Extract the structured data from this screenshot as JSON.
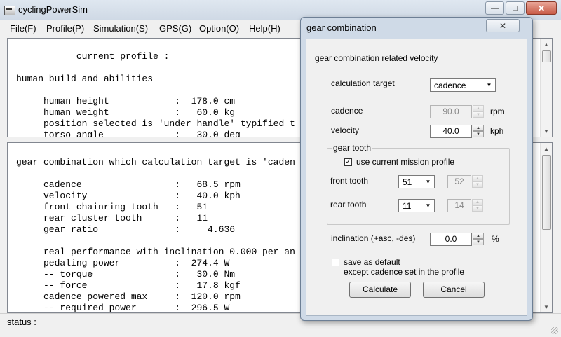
{
  "window": {
    "title": "cyclingPowerSim",
    "icon": "app-icon"
  },
  "menu": [
    "File(F)",
    "Profile(P)",
    "Simulation(S)",
    "GPS(G)",
    "Option(O)",
    "Help(H)"
  ],
  "top_pane": {
    "lines": [
      "           current profile :",
      "",
      "human build and abilities",
      "",
      "     human height            :  178.0 cm",
      "     human weight            :   60.0 kg",
      "     position selected is 'under handle' typified t",
      "     torso angle             :   30.0 deg"
    ]
  },
  "bottom_pane": {
    "lines": [
      "gear combination which calculation target is 'caden",
      "",
      "     cadence                 :   68.5 rpm",
      "     velocity                :   40.0 kph",
      "     front chainring tooth   :   51",
      "     rear cluster tooth      :   11",
      "     gear ratio              :     4.636",
      "",
      "     real performance with inclination 0.000 per an",
      "     pedaling power          :  274.4 W",
      "     -- torque               :   30.0 Nm",
      "     -- force                :   17.8 kgf",
      "     cadence powered max     :  120.0 rpm",
      "     -- required power       :  296.5 W"
    ]
  },
  "status": {
    "label": "status :"
  },
  "dialog": {
    "title": "gear combination",
    "heading": "gear combination related velocity",
    "calc_target_label": "calculation target",
    "calc_target_value": "cadence",
    "cadence_label": "cadence",
    "cadence_value": "90.0",
    "cadence_unit": "rpm",
    "velocity_label": "velocity",
    "velocity_value": "40.0",
    "velocity_unit": "kph",
    "gear_group_title": "gear tooth",
    "use_mission_label": "use current mission profile",
    "use_mission_checked": true,
    "front_label": "front tooth",
    "front_value": "51",
    "front_spin_value": "52",
    "rear_label": "rear tooth",
    "rear_value": "11",
    "rear_spin_value": "14",
    "incl_label": "inclination (+asc, -des)",
    "incl_value": "0.0",
    "incl_unit": "%",
    "save_default_line1": "save as default",
    "save_default_line2": "except cadence set in the profile",
    "save_default_checked": false,
    "calculate_label": "Calculate",
    "cancel_label": "Cancel"
  },
  "colors": {
    "dialog_frame": "#cfdae7",
    "close_button": "#c85b47"
  }
}
